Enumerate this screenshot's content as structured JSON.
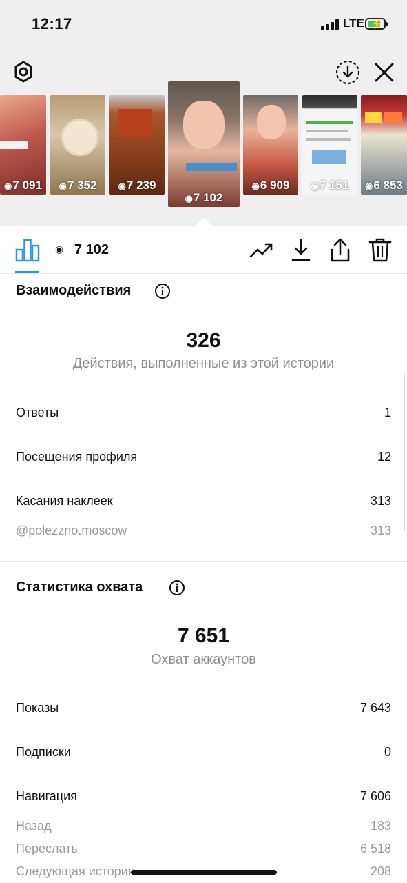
{
  "status_bar": {
    "time": "12:17",
    "network": "LTE"
  },
  "colors": {
    "accent": "#2c9ad8",
    "battery": "#43c95a",
    "muted": "#8e8e8e"
  },
  "top_bar": {
    "left_icon": "settings-icon",
    "right_icons": [
      "download-circle-icon",
      "close-icon"
    ]
  },
  "stories": [
    {
      "views": "7 091",
      "selected": false
    },
    {
      "views": "7 352",
      "selected": false
    },
    {
      "views": "7 239",
      "selected": false
    },
    {
      "views": "7 102",
      "selected": true
    },
    {
      "views": "6 909",
      "selected": false
    },
    {
      "views": "7 151",
      "selected": false
    },
    {
      "views": "6 853",
      "selected": false
    }
  ],
  "toolbar": {
    "view_count": "7 102",
    "icons": [
      "bar-chart-icon",
      "eye-icon",
      "trending-icon",
      "download-icon",
      "share-icon",
      "trash-icon"
    ]
  },
  "interactions": {
    "title": "Взаимодействия",
    "total": "326",
    "total_label": "Действия, выполненные из этой истории",
    "rows": [
      {
        "label": "Ответы",
        "value": "1"
      },
      {
        "label": "Посещения профиля",
        "value": "12"
      },
      {
        "label": "Касания наклеек",
        "value": "313"
      }
    ],
    "sub_rows": [
      {
        "label": "@polezzno.moscow",
        "value": "313"
      }
    ]
  },
  "reach": {
    "title": "Статистика охвата",
    "total": "7 651",
    "total_label": "Охват аккаунтов",
    "rows": [
      {
        "label": "Показы",
        "value": "7 643"
      },
      {
        "label": "Подписки",
        "value": "0"
      },
      {
        "label": "Навигация",
        "value": "7 606"
      }
    ],
    "sub_rows": [
      {
        "label": "Назад",
        "value": "183"
      },
      {
        "label": "Переслать",
        "value": "6 518"
      },
      {
        "label": "Следующая история",
        "value": "208"
      }
    ]
  }
}
